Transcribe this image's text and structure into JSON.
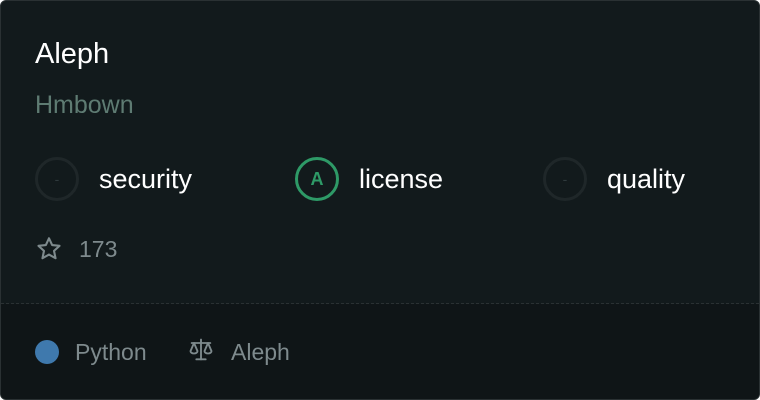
{
  "repo": {
    "name": "Aleph",
    "owner": "Hmbown"
  },
  "grades": [
    {
      "label": "security",
      "grade": "-",
      "status": "none",
      "color": "#1f2729"
    },
    {
      "label": "license",
      "grade": "A",
      "status": "good",
      "color": "#2e9a67"
    },
    {
      "label": "quality",
      "grade": "-",
      "status": "none",
      "color": "#1f2729"
    }
  ],
  "stars": {
    "icon": "star-icon",
    "count": "173"
  },
  "footer": {
    "language": {
      "name": "Python",
      "color": "#3f79ad"
    },
    "license": {
      "icon": "scale-icon",
      "name": "Aleph"
    }
  },
  "colors": {
    "card_background": "#121a1c",
    "footer_background": "#0f1517",
    "owner_text": "#5e7b72",
    "muted_text": "#7e8a8d"
  }
}
